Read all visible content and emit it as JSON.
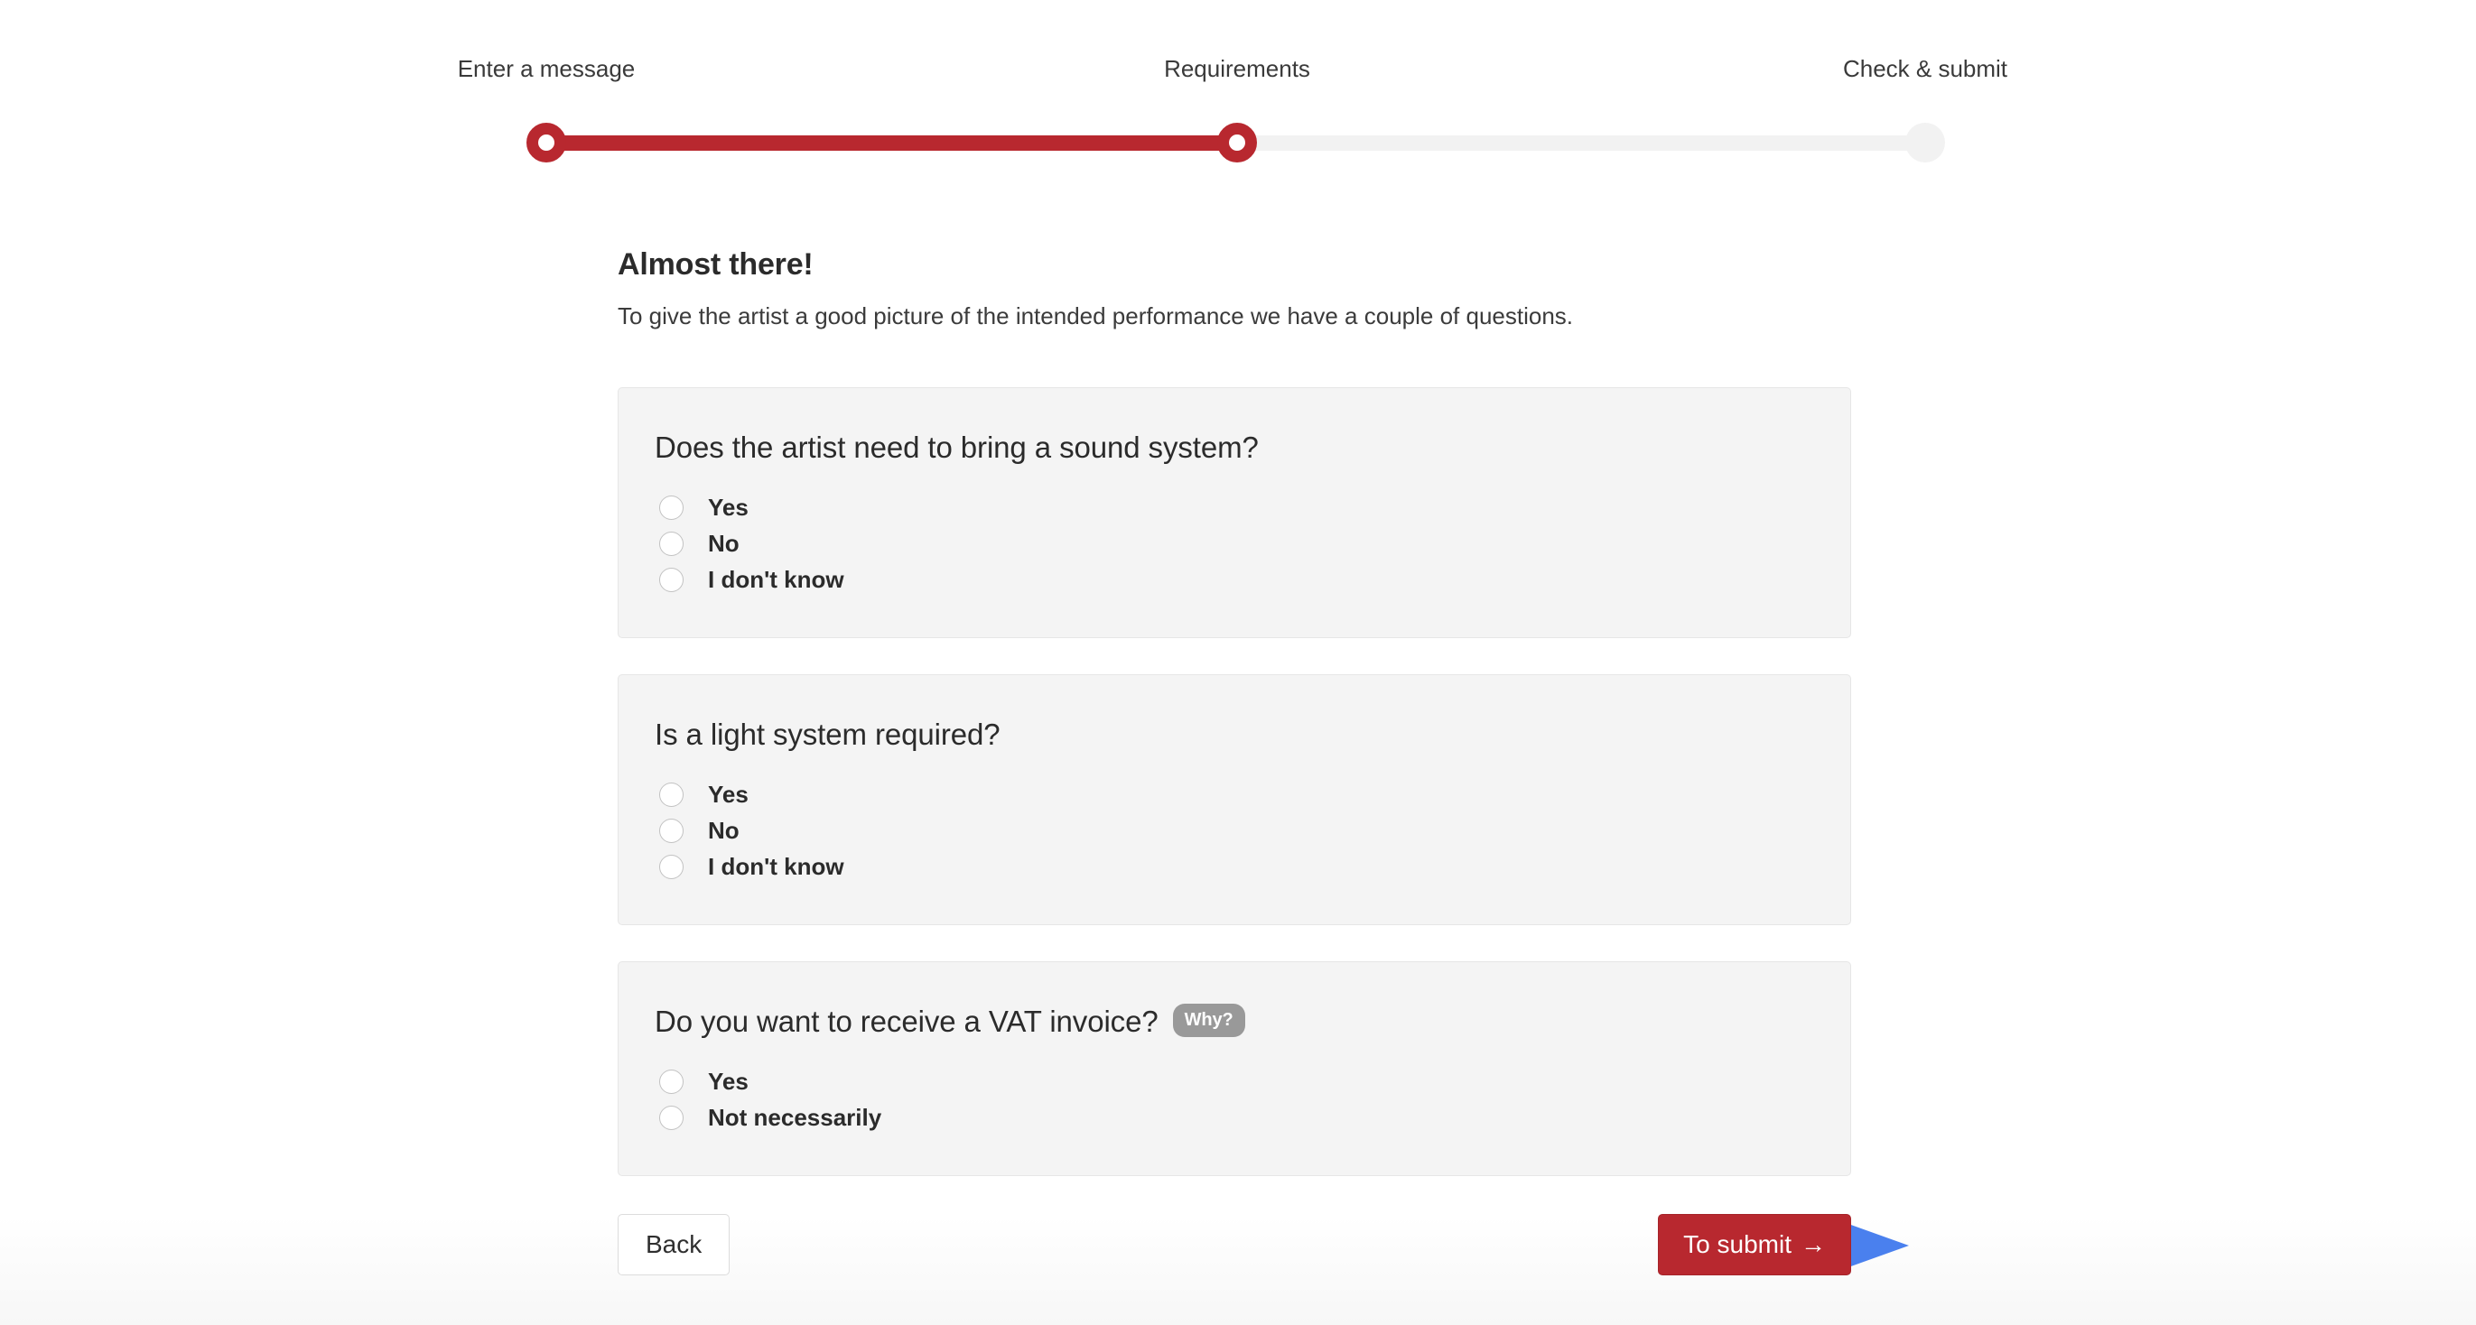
{
  "stepper": {
    "steps": [
      {
        "label": "Enter a message",
        "state": "done"
      },
      {
        "label": "Requirements",
        "state": "current"
      },
      {
        "label": "Check & submit",
        "state": "todo"
      }
    ],
    "accent_color": "#b8282f",
    "inactive_color": "#f2f2f2"
  },
  "main": {
    "headline": "Almost there!",
    "subhead": "To give the artist a good picture of the intended performance we have a couple of questions.",
    "questions": [
      {
        "title": "Does the artist need to bring a sound system?",
        "badge": null,
        "options": [
          {
            "label": "Yes",
            "selected": false
          },
          {
            "label": "No",
            "selected": false
          },
          {
            "label": "I don't know",
            "selected": false
          }
        ]
      },
      {
        "title": "Is a light system required?",
        "badge": null,
        "options": [
          {
            "label": "Yes",
            "selected": false
          },
          {
            "label": "No",
            "selected": false
          },
          {
            "label": "I don't know",
            "selected": false
          }
        ]
      },
      {
        "title": "Do you want to receive a VAT invoice?",
        "badge": "Why?",
        "options": [
          {
            "label": "Yes",
            "selected": false
          },
          {
            "label": "Not necessarily",
            "selected": false
          }
        ]
      }
    ]
  },
  "actions": {
    "back_label": "Back",
    "submit_label": "To submit",
    "submit_arrow_glyph": "→",
    "submit_color": "#b8282f"
  },
  "annotation": {
    "type": "arrow",
    "direction": "right",
    "color": "#4a80ee",
    "points_to": "To submit"
  }
}
